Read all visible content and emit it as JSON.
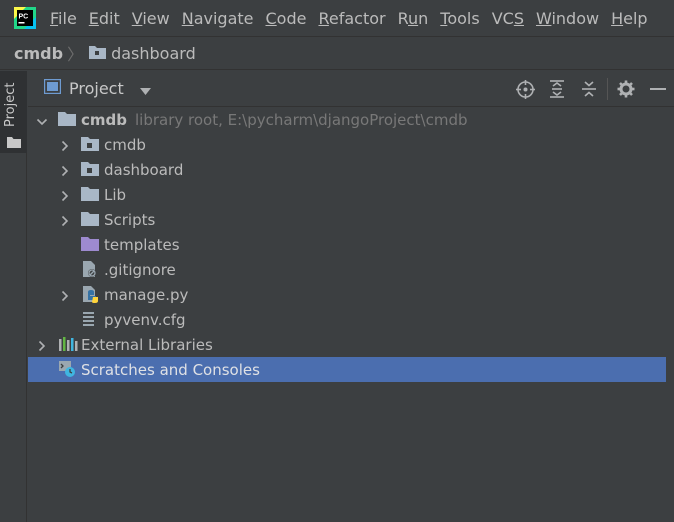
{
  "app": {
    "logo_text": "PC"
  },
  "menu": [
    {
      "pre": "",
      "mn": "F",
      "post": "ile"
    },
    {
      "pre": "",
      "mn": "E",
      "post": "dit"
    },
    {
      "pre": "",
      "mn": "V",
      "post": "iew"
    },
    {
      "pre": "",
      "mn": "N",
      "post": "avigate"
    },
    {
      "pre": "",
      "mn": "C",
      "post": "ode"
    },
    {
      "pre": "",
      "mn": "R",
      "post": "efactor"
    },
    {
      "pre": "R",
      "mn": "u",
      "post": "n"
    },
    {
      "pre": "",
      "mn": "T",
      "post": "ools"
    },
    {
      "pre": "VC",
      "mn": "S",
      "post": ""
    },
    {
      "pre": "",
      "mn": "W",
      "post": "indow"
    },
    {
      "pre": "",
      "mn": "H",
      "post": "elp"
    }
  ],
  "breadcrumb": {
    "root": "cmdb",
    "folder": "dashboard"
  },
  "left_stripe": {
    "label": "Project"
  },
  "tool_window": {
    "title": "Project"
  },
  "tree": {
    "root": {
      "name": "cmdb",
      "hint": "library root,  E:\\pycharm\\djangoProject\\cmdb"
    },
    "items": [
      {
        "name": "cmdb"
      },
      {
        "name": "dashboard"
      },
      {
        "name": "Lib"
      },
      {
        "name": "Scripts"
      },
      {
        "name": "templates"
      },
      {
        "name": ".gitignore"
      },
      {
        "name": "manage.py"
      },
      {
        "name": "pyvenv.cfg"
      }
    ],
    "external": {
      "name": "External Libraries"
    },
    "scratches": {
      "name": "Scratches and Consoles"
    }
  },
  "colors": {
    "background": "#3c3f41",
    "selection": "#4b6eaf",
    "folder": "#a9b7c6",
    "template_folder": "#9d8acf",
    "accent_green": "#21d789"
  }
}
